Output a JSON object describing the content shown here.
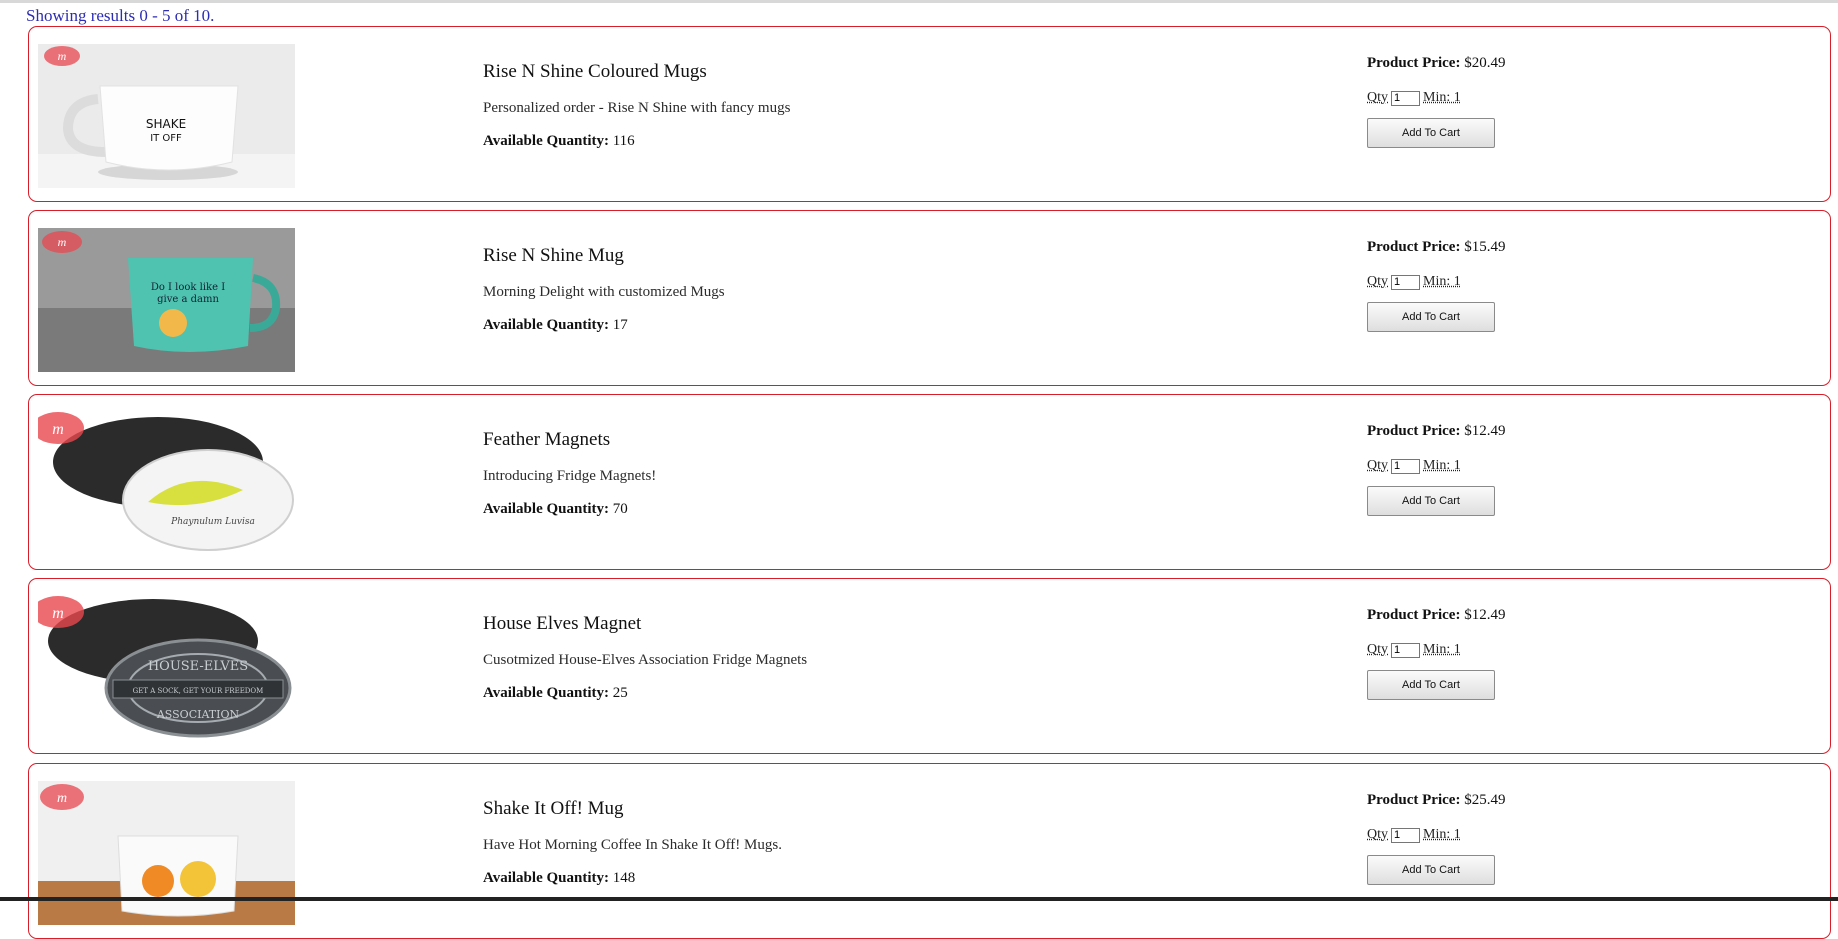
{
  "results_text": "Showing results 0 - 5 of 10.",
  "labels": {
    "price": "Product Price:",
    "available": "Available Quantity:",
    "qty": "Qty",
    "min": "Min: 1",
    "add_to_cart": "Add To Cart"
  },
  "products": [
    {
      "title": "Rise N Shine Coloured Mugs",
      "desc": "Personalized order - Rise N Shine with fancy mugs",
      "available": "116",
      "price": "$20.49",
      "qty": "1",
      "image": "white-mug-shake-it-off"
    },
    {
      "title": "Rise N Shine Mug",
      "desc": "Morning Delight with customized Mugs",
      "available": "17",
      "price": "$15.49",
      "qty": "1",
      "image": "teal-mug"
    },
    {
      "title": "Feather Magnets",
      "desc": "Introducing Fridge Magnets!",
      "available": "70",
      "price": "$12.49",
      "qty": "1",
      "image": "feather-magnet"
    },
    {
      "title": "House Elves Magnet",
      "desc": "Cusotmized House-Elves Association Fridge Magnets",
      "available": "25",
      "price": "$12.49",
      "qty": "1",
      "image": "house-elves-magnet"
    },
    {
      "title": "Shake It Off! Mug",
      "desc": "Have Hot Morning Coffee In Shake It Off! Mugs.",
      "available": "148",
      "price": "$25.49",
      "qty": "1",
      "image": "cartoon-mug"
    }
  ],
  "colors": {
    "card_border": "#d81e2a",
    "results_text": "#2d2db4",
    "logo_red": "#e8474f"
  }
}
